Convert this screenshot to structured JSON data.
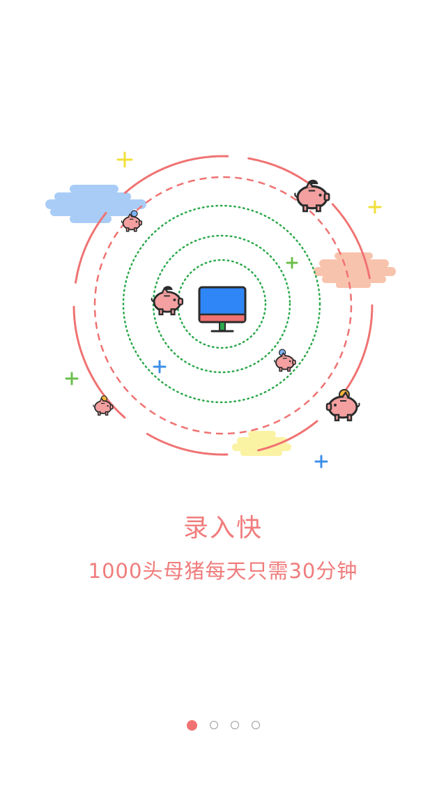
{
  "slide": {
    "title": "录入快",
    "subtitle": "1000头母猪每天只需30分钟"
  },
  "pagination": {
    "total": 4,
    "active_index": 0
  },
  "colors": {
    "accent": "#f07272",
    "text": "#f07c7c",
    "monitor_screen": "#2f86f6",
    "pig": "#f4a0a0",
    "orbit_green": "#2aa84a"
  },
  "icons": [
    "monitor-icon",
    "piggy-bank-icon",
    "coin-icon",
    "plus-sparkle-icon",
    "cloud-icon"
  ]
}
